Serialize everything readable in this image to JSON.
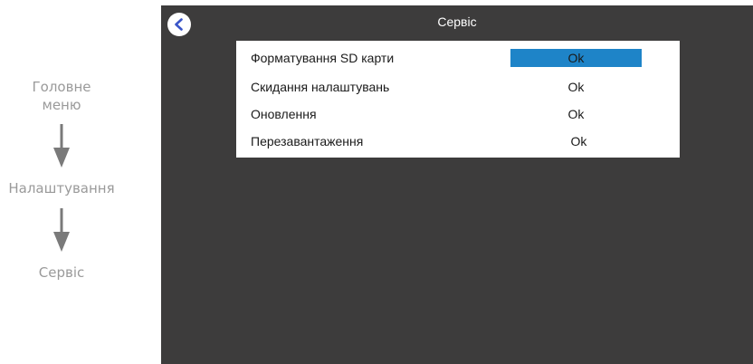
{
  "nav_path": {
    "step1": "Головне\nменю",
    "step2": "Налаштування",
    "step3": "Сервіс"
  },
  "screen": {
    "title": "Сервіс",
    "back_icon": "chevron-left-icon",
    "rows": [
      {
        "label": "Форматування SD карти",
        "action": "Ok",
        "selected": true
      },
      {
        "label": "Скидання налаштувань",
        "action": "Ok",
        "selected": false
      },
      {
        "label": "Оновлення",
        "action": "Ok",
        "selected": false
      },
      {
        "label": "Перезавантаження",
        "action": "Ok",
        "selected": false
      }
    ],
    "colors": {
      "background": "#3d3c3c",
      "accent": "#1e84c8"
    }
  }
}
